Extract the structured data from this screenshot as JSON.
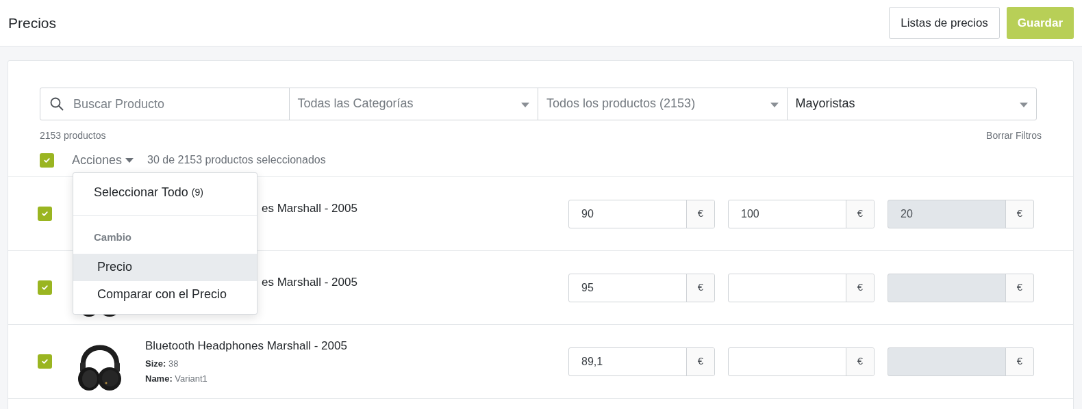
{
  "header": {
    "title": "Precios",
    "buttons": [
      {
        "label": "Listas de precios",
        "kind": "secondary"
      },
      {
        "label": "Guardar",
        "kind": "primary"
      }
    ]
  },
  "filters": {
    "search": {
      "placeholder": "Buscar Producto"
    },
    "dropdowns": [
      {
        "value": "Todas las Categorías",
        "placeholder": true
      },
      {
        "value": "Todos los productos (2153)",
        "placeholder": true
      },
      {
        "value": "Mayoristas",
        "placeholder": false
      }
    ]
  },
  "count": "2153 productos",
  "clear_filters": "Borrar Filtros",
  "toolbar": {
    "select_all_checked": true,
    "actions": "Acciones",
    "selection": "30 de 2153 productos seleccionados"
  },
  "actions_menu": {
    "items": [
      {
        "kind": "item",
        "label": "Seleccionar Todo",
        "count": "(9)",
        "selected": false
      },
      {
        "kind": "divider"
      },
      {
        "kind": "header",
        "label": "Cambio"
      },
      {
        "kind": "item",
        "label": "Precio",
        "selected": true
      },
      {
        "kind": "item",
        "label": "Comparar con el Precio",
        "selected": false
      }
    ]
  },
  "rows": [
    {
      "checked": true,
      "covered": true,
      "image": false,
      "title": "es Marshall - 2005",
      "prices": [
        {
          "value": "90",
          "currency": "€",
          "disabled": false
        },
        {
          "value": "100",
          "currency": "€",
          "disabled": false
        },
        {
          "value": "20",
          "currency": "€",
          "disabled": true
        }
      ]
    },
    {
      "checked": true,
      "covered": true,
      "image": true,
      "title": "es Marshall - 2005",
      "prices": [
        {
          "value": "95",
          "currency": "€",
          "disabled": false
        },
        {
          "currency": "€",
          "disabled": false
        },
        {
          "currency": "€",
          "disabled": true
        }
      ]
    },
    {
      "checked": true,
      "covered": false,
      "image": true,
      "title": "Bluetooth Headphones Marshall - 2005",
      "attributes": [
        {
          "label": "Size:",
          "value": "38"
        },
        {
          "label": "Name:",
          "value": "Variant1"
        }
      ],
      "prices": [
        {
          "value": "89,1",
          "currency": "€",
          "disabled": false
        },
        {
          "currency": "€",
          "disabled": false
        },
        {
          "currency": "€",
          "disabled": true
        }
      ]
    }
  ]
}
